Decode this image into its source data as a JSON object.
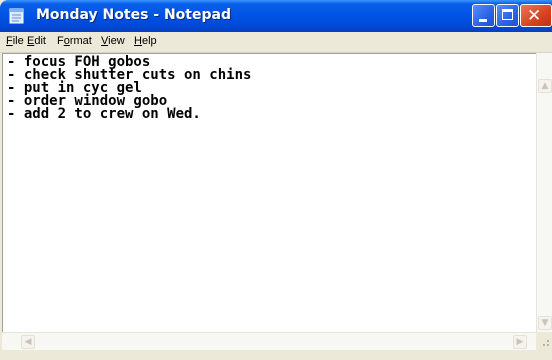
{
  "window": {
    "title": "Monday Notes - Notepad",
    "icon": "notepad-icon",
    "controls": [
      "minimize-icon",
      "maximize-icon",
      "close-icon"
    ],
    "colors": {
      "titlebar": "#0055e5",
      "close_button": "#d5441f"
    }
  },
  "menu": {
    "file": {
      "accel": "F",
      "rest": "ile"
    },
    "edit": {
      "accel": "E",
      "rest": "dit"
    },
    "format": {
      "pre": "F",
      "accel": "o",
      "rest": "rmat"
    },
    "view": {
      "accel": "V",
      "rest": "iew"
    },
    "help": {
      "accel": "H",
      "rest": "elp"
    }
  },
  "document": {
    "lines": [
      "- focus FOH gobos",
      "- check shutter cuts on chins",
      "- put in cyc gel",
      "- order window gobo",
      "- add 2 to crew on Wed."
    ]
  },
  "scrollbars": {
    "up_arrow": "▲",
    "down_arrow": "▼",
    "left_arrow": "◀",
    "right_arrow": "▶"
  }
}
